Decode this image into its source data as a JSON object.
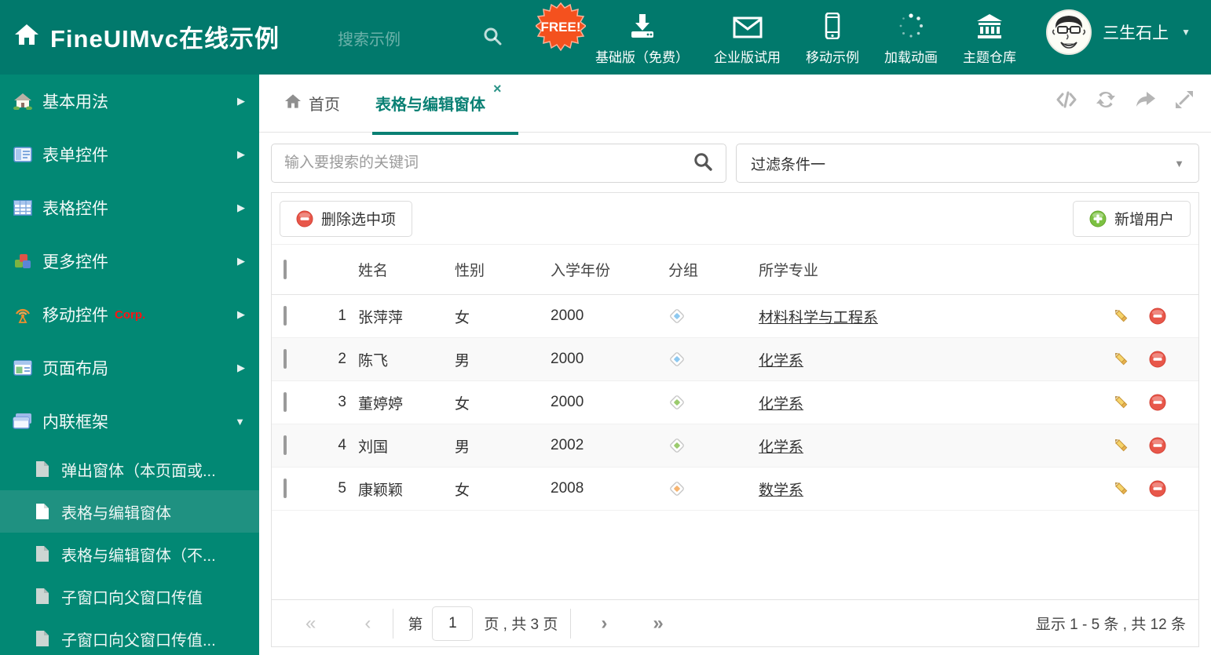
{
  "header": {
    "title": "FineUIMvc在线示例",
    "search_placeholder": "搜索示例",
    "free_badge": "FREE!",
    "nav_items": [
      {
        "label": "基础版（免费）",
        "icon": "download-icon"
      },
      {
        "label": "企业版试用",
        "icon": "envelope-icon"
      },
      {
        "label": "移动示例",
        "icon": "mobile-icon"
      },
      {
        "label": "加载动画",
        "icon": "spinner-icon"
      },
      {
        "label": "主题仓库",
        "icon": "bank-icon"
      }
    ],
    "user": {
      "name": "三生石上"
    }
  },
  "sidebar": {
    "items": [
      {
        "label": "基本用法",
        "icon": "house-icon",
        "expanded": false
      },
      {
        "label": "表单控件",
        "icon": "form-icon",
        "expanded": false
      },
      {
        "label": "表格控件",
        "icon": "table-icon",
        "expanded": false
      },
      {
        "label": "更多控件",
        "icon": "cubes-icon",
        "expanded": false
      },
      {
        "label": "移动控件",
        "badge": "Corp.",
        "icon": "antenna-icon",
        "expanded": false
      },
      {
        "label": "页面布局",
        "icon": "layout-icon",
        "expanded": false
      },
      {
        "label": "内联框架",
        "icon": "frames-icon",
        "expanded": true
      }
    ],
    "subitems": [
      {
        "label": "弹出窗体（本页面或...",
        "selected": false
      },
      {
        "label": "表格与编辑窗体",
        "selected": true
      },
      {
        "label": "表格与编辑窗体（不...",
        "selected": false
      },
      {
        "label": "子窗口向父窗口传值",
        "selected": false
      },
      {
        "label": "子窗口向父窗口传值...",
        "selected": false
      }
    ]
  },
  "tabs": {
    "home_label": "首页",
    "active_label": "表格与编辑窗体",
    "close_glyph": "×"
  },
  "filters": {
    "search_placeholder": "输入要搜索的关键词",
    "filter_value": "过滤条件一"
  },
  "grid_toolbar": {
    "delete_label": "删除选中项",
    "add_label": "新增用户"
  },
  "table": {
    "columns": {
      "name": "姓名",
      "gender": "性别",
      "year": "入学年份",
      "group": "分组",
      "major": "所学专业"
    },
    "rows": [
      {
        "index": "1",
        "name": "张萍萍",
        "gender": "女",
        "year": "2000",
        "tag_hex": "#8ec9f0",
        "major": "材料科学与工程系"
      },
      {
        "index": "2",
        "name": "陈飞",
        "gender": "男",
        "year": "2000",
        "tag_hex": "#8ec9f0",
        "major": "化学系"
      },
      {
        "index": "3",
        "name": "董婷婷",
        "gender": "女",
        "year": "2000",
        "tag_hex": "#9bcb6e",
        "major": "化学系"
      },
      {
        "index": "4",
        "name": "刘国",
        "gender": "男",
        "year": "2002",
        "tag_hex": "#9bcb6e",
        "major": "化学系"
      },
      {
        "index": "5",
        "name": "康颖颖",
        "gender": "女",
        "year": "2008",
        "tag_hex": "#f6b470",
        "major": "数学系"
      }
    ]
  },
  "pagination": {
    "page_prefix": "第",
    "page_value": "1",
    "page_suffix": "页 , 共 3 页",
    "summary": "显示 1 - 5 条 , 共 12 条"
  },
  "icons": {
    "pager_first": "«",
    "pager_prev": "‹",
    "pager_next": "›",
    "pager_last": "»",
    "dropdown_caret": "▼",
    "menu_arrow_collapsed": "▶",
    "menu_arrow_expanded": "▼"
  },
  "colors": {
    "header_bg": "#01796c",
    "sidebar_bg": "#028874",
    "selected_item_bg": "#1f9181",
    "accent_teal": "#0a8074",
    "free_badge_orange": "#f4511e",
    "corp_red": "#ff1313",
    "delete_red": "#e8574a",
    "add_green": "#7cc142",
    "pencil_gold": "#f5d36a"
  }
}
